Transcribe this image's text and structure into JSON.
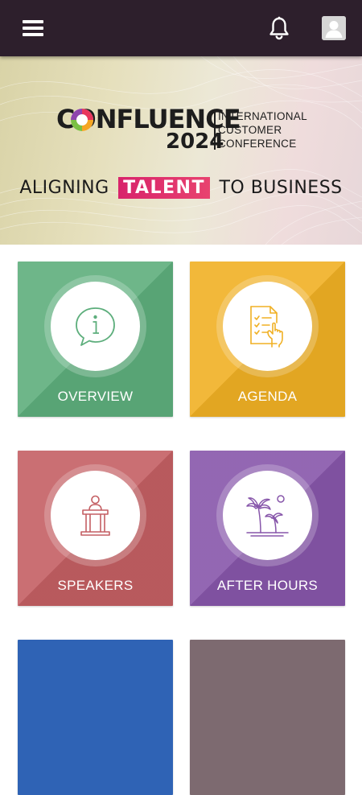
{
  "topbar": {
    "menu_icon": "hamburger-menu-icon",
    "bell_icon": "bell-icon",
    "avatar_icon": "user-avatar-icon",
    "bg_color": "#2d1f2c"
  },
  "banner": {
    "logo_word": "CONFLUENCE",
    "logo_year": "2024",
    "logo_sub_line1": "INTERNATIONAL",
    "logo_sub_line2": "CUSTOMER",
    "logo_sub_line3": "CONFERENCE",
    "tagline_before": "ALIGNING",
    "tagline_highlight": "TALENT",
    "tagline_after": "TO BUSINESS",
    "highlight_color": "#d8236b"
  },
  "tiles": [
    {
      "label": "OVERVIEW",
      "icon": "info-chat-icon",
      "color": "#5dae7c"
    },
    {
      "label": "AGENDA",
      "icon": "checklist-hand-icon",
      "color": "#f0b024"
    },
    {
      "label": "SPEAKERS",
      "icon": "podium-speaker-icon",
      "color": "#c45f63"
    },
    {
      "label": "AFTER HOURS",
      "icon": "palm-trees-icon",
      "color": "#8756aa"
    }
  ],
  "partial_tiles": [
    {
      "color": "#2f63b5"
    },
    {
      "color": "#7d6a70"
    }
  ]
}
